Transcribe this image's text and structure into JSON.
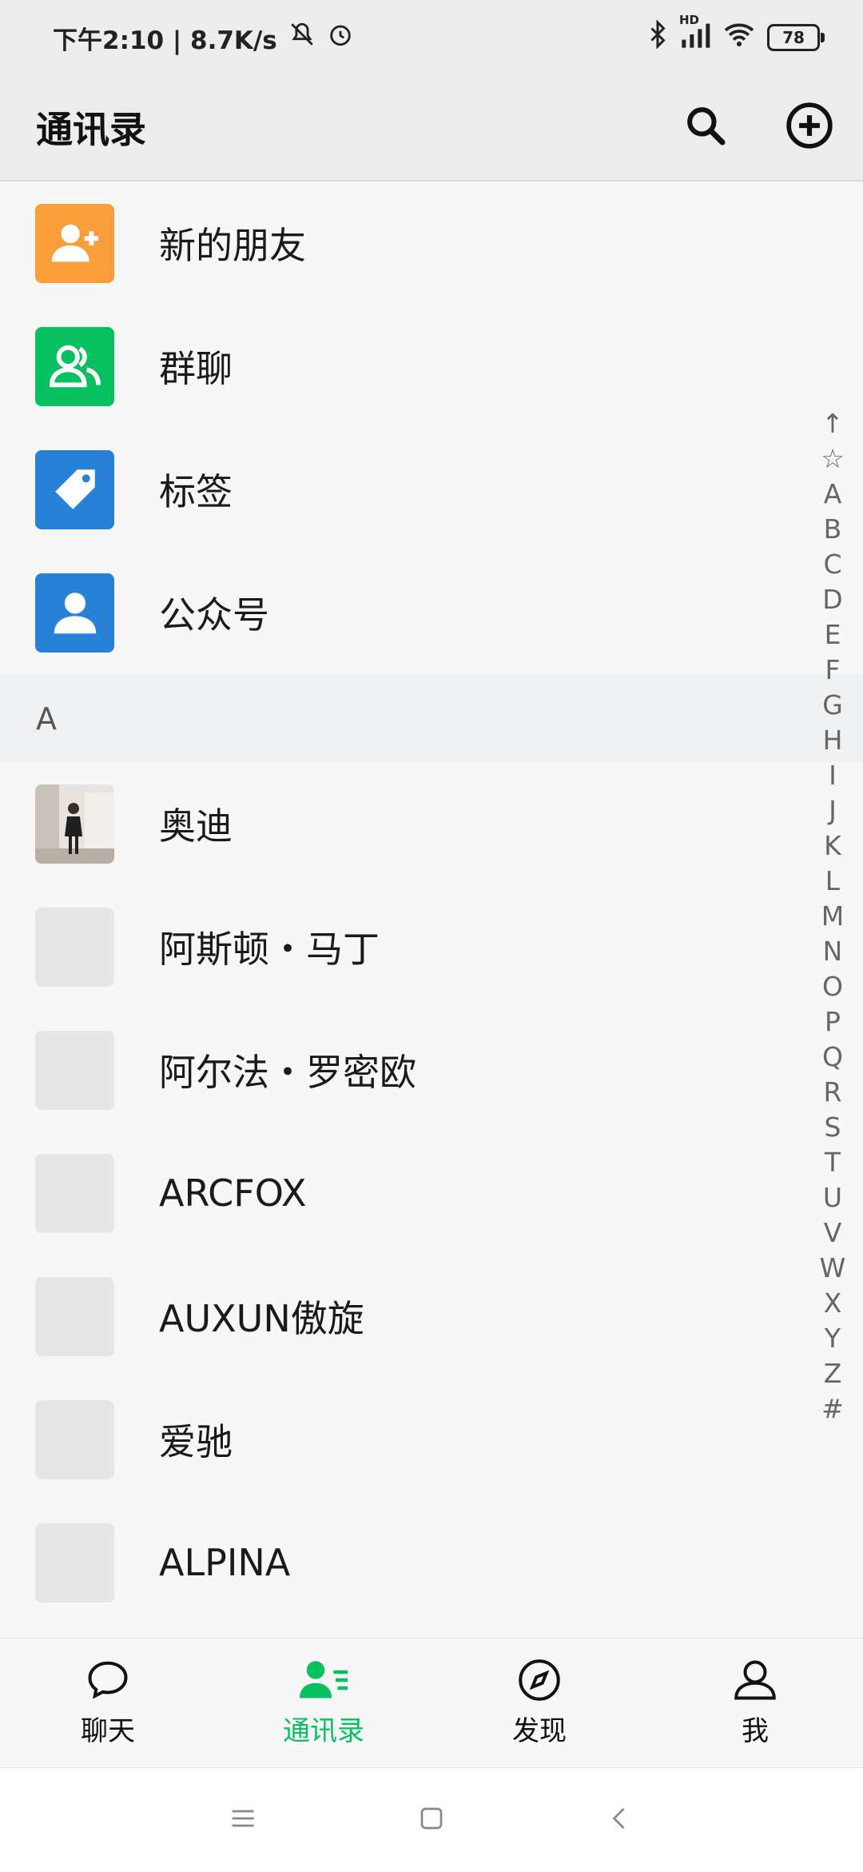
{
  "status_bar": {
    "time_speed": "下午2:10 | 8.7K/s",
    "network": "HD",
    "battery": "78"
  },
  "header": {
    "title": "通讯录"
  },
  "top_items": [
    {
      "label": "新的朋友",
      "icon": "add-friend-icon",
      "color": "#fa9d3b"
    },
    {
      "label": "群聊",
      "icon": "group-chat-icon",
      "color": "#07c160"
    },
    {
      "label": "标签",
      "icon": "tag-icon",
      "color": "#2782d7"
    },
    {
      "label": "公众号",
      "icon": "official-account-icon",
      "color": "#2782d7"
    }
  ],
  "section": {
    "letter": "A"
  },
  "contacts": [
    {
      "name": "奥迪",
      "avatar": "photo"
    },
    {
      "name": "阿斯顿・马丁",
      "avatar": "placeholder"
    },
    {
      "name": "阿尔法・罗密欧",
      "avatar": "placeholder"
    },
    {
      "name": "ARCFOX",
      "avatar": "placeholder"
    },
    {
      "name": "AUXUN傲旋",
      "avatar": "placeholder"
    },
    {
      "name": "爱驰",
      "avatar": "placeholder"
    },
    {
      "name": "ALPINA",
      "avatar": "placeholder"
    }
  ],
  "index_bar": [
    "↑",
    "☆",
    "A",
    "B",
    "C",
    "D",
    "E",
    "F",
    "G",
    "H",
    "I",
    "J",
    "K",
    "L",
    "M",
    "N",
    "O",
    "P",
    "Q",
    "R",
    "S",
    "T",
    "U",
    "V",
    "W",
    "X",
    "Y",
    "Z",
    "#"
  ],
  "tabs": [
    {
      "label": "聊天",
      "icon": "chat-icon",
      "active": false
    },
    {
      "label": "通讯录",
      "icon": "contacts-icon",
      "active": true
    },
    {
      "label": "发现",
      "icon": "discover-icon",
      "active": false
    },
    {
      "label": "我",
      "icon": "me-icon",
      "active": false
    }
  ],
  "colors": {
    "accent": "#07c160",
    "header_bg": "#ededed",
    "section_bg": "#f0f1f2"
  }
}
